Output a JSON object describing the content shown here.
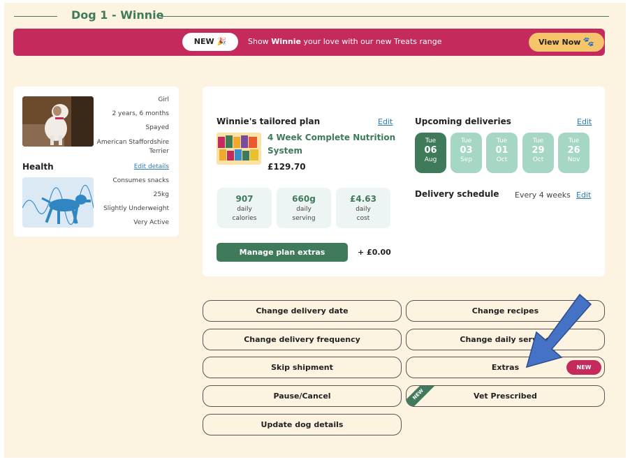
{
  "header": {
    "title": "Dog 1 - Winnie"
  },
  "banner": {
    "new_label": "NEW 🎉",
    "message_pre": "Show ",
    "message_name": "Winnie",
    "message_post": " your love with our new Treats range",
    "button_label": "View Now",
    "button_icon": "🐾"
  },
  "dog": {
    "attributes": [
      "Girl",
      "2 years, 6 months",
      "Spayed",
      "American Staffordshire Terrier"
    ],
    "health_label": "Health",
    "edit_details": "Edit details",
    "health_attributes": [
      "Consumes snacks",
      "25kg",
      "Slightly Underweight",
      "Very Active"
    ]
  },
  "plan": {
    "title": "Winnie's tailored plan",
    "edit": "Edit",
    "name": "4 Week Complete Nutrition System",
    "price": "£129.70",
    "stats": [
      {
        "value": "907",
        "label1": "daily",
        "label2": "calories"
      },
      {
        "value": "660g",
        "label1": "daily",
        "label2": "serving"
      },
      {
        "value": "£4.63",
        "label1": "daily",
        "label2": "cost"
      }
    ],
    "manage_extras": "Manage plan extras",
    "extras_price": "+ £0.00"
  },
  "deliveries": {
    "title": "Upcoming deliveries",
    "edit": "Edit",
    "dates": [
      {
        "day": "Tue",
        "num": "06",
        "month": "Aug",
        "active": true
      },
      {
        "day": "Tue",
        "num": "03",
        "month": "Sep",
        "active": false
      },
      {
        "day": "Tue",
        "num": "01",
        "month": "Oct",
        "active": false
      },
      {
        "day": "Tue",
        "num": "29",
        "month": "Oct",
        "active": false
      },
      {
        "day": "Tue",
        "num": "26",
        "month": "Nov",
        "active": false
      }
    ],
    "schedule_title": "Delivery schedule",
    "schedule_value": "Every 4 weeks",
    "schedule_edit": "Edit"
  },
  "actions": {
    "change_date": "Change delivery date",
    "change_recipes": "Change recipes",
    "change_frequency": "Change delivery frequency",
    "change_serving": "Change daily serving",
    "skip": "Skip shipment",
    "extras": "Extras",
    "extras_badge": "NEW",
    "pause": "Pause/Cancel",
    "vet": "Vet Prescribed",
    "vet_ribbon": "NEW",
    "update": "Update dog details"
  },
  "colors": {
    "brand_green": "#3f7a5a",
    "brand_pink": "#c52a5c",
    "accent_yellow": "#f6c46b",
    "light_green": "#a6d6c4",
    "background": "#fdf3e1"
  }
}
